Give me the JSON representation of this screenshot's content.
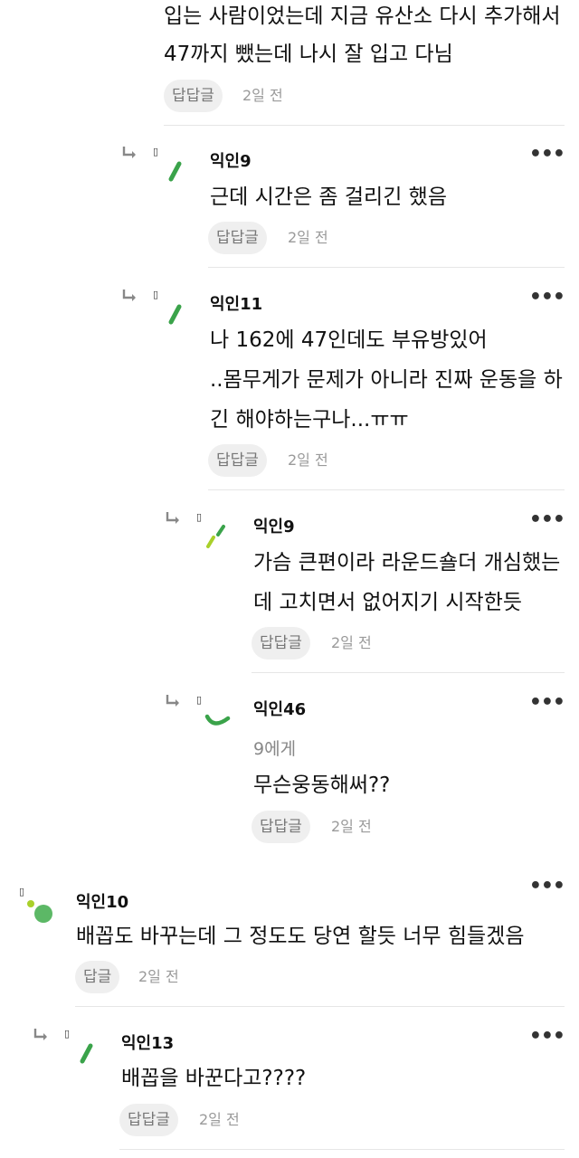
{
  "top_comment": {
    "lines": [
      "입는 사람이었는데 지금 유산소 다시 추가해서",
      "47까지 뺐는데 나시 잘 입고 다님"
    ],
    "reply_label": "답답글",
    "time": "2일 전"
  },
  "comments": [
    {
      "name": "익인9",
      "lines": [
        "근데 시간은 좀 걸리긴 했음"
      ],
      "reply_label": "답답글",
      "time": "2일 전",
      "more": "•••"
    },
    {
      "name": "익인11",
      "lines": [
        "나 162에 47인데도 부유방있어",
        "..몸무게가 문제가 아니라 진짜 운동을 하",
        "긴 해야하는구나...ㅠㅠ"
      ],
      "reply_label": "답답글",
      "time": "2일 전",
      "more": "•••"
    },
    {
      "name": "익인9",
      "lines": [
        "가슴 큰편이라 라운드숄더 개심했는",
        "데 고치면서 없어지기 시작한듯"
      ],
      "reply_label": "답답글",
      "time": "2일 전",
      "more": "•••"
    },
    {
      "name": "익인46",
      "to": "9에게",
      "lines": [
        "무슨웅동해써??"
      ],
      "reply_label": "답답글",
      "time": "2일 전",
      "more": "•••"
    },
    {
      "name": "익인10",
      "lines": [
        "배꼽도 바꾸는데 그 정도도 당연 할듯 너무 힘들겠음"
      ],
      "reply_label": "답글",
      "time": "2일 전",
      "more": "•••"
    },
    {
      "name": "익인13",
      "lines": [
        "배꼽을 바꾼다고????"
      ],
      "reply_label": "답답글",
      "time": "2일 전",
      "more": "•••"
    }
  ],
  "icons": {
    "reply_arrow": "reply-arrow-icon",
    "more": "more-options-icon"
  },
  "colors": {
    "avatar_green": "#3aa34a",
    "avatar_yellow_green": "#a9d02a",
    "reply_button_bg": "#efefef",
    "divider": "#e6e6e6"
  }
}
